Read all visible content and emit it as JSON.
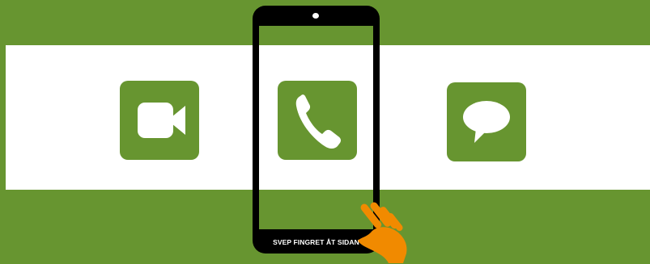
{
  "colors": {
    "background": "#679530",
    "band": "#ffffff",
    "tile": "#679530",
    "phone_frame": "#000000",
    "hand": "#f18a00"
  },
  "apps": [
    {
      "name": "video-call",
      "icon": "video-camera-icon"
    },
    {
      "name": "phone-call",
      "icon": "phone-handset-icon"
    },
    {
      "name": "message",
      "icon": "speech-bubble-icon"
    }
  ],
  "phone": {
    "caption": "SVEP FINGRET ÅT SIDAN"
  },
  "gesture": {
    "icon": "swiping-hand-icon"
  }
}
